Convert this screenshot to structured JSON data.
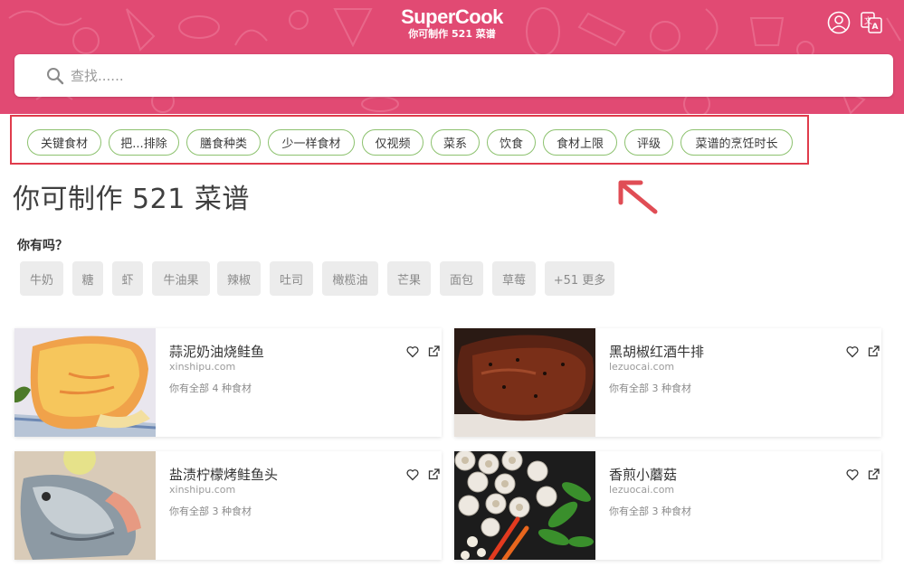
{
  "header": {
    "brand": "SuperCook",
    "subtitle": "你可制作 521 菜谱",
    "bg_color": "#e14a73",
    "icons": [
      "user-icon",
      "translate-icon"
    ]
  },
  "search": {
    "placeholder": "查找......"
  },
  "filters": [
    {
      "label": "关键食材"
    },
    {
      "label": "把...排除"
    },
    {
      "label": "膳食种类"
    },
    {
      "label": "少一样食材"
    },
    {
      "label": "仅视频"
    },
    {
      "label": "菜系"
    },
    {
      "label": "饮食"
    },
    {
      "label": "食材上限"
    },
    {
      "label": "评级"
    },
    {
      "label": "菜谱的烹饪时长"
    }
  ],
  "highlight_color": "#e03c4c",
  "main": {
    "title": "你可制作 521 菜谱",
    "have_label": "你有吗？",
    "suggestions": [
      "牛奶",
      "糖",
      "虾",
      "牛油果",
      "辣椒",
      "吐司",
      "橄榄油",
      "芒果",
      "面包",
      "草莓",
      "+51 更多"
    ]
  },
  "recipes": [
    {
      "title": "蒜泥奶油烧鲑鱼",
      "source": "xinshipu.com",
      "meta": "你有全部 4 种食材"
    },
    {
      "title": "黑胡椒红酒牛排",
      "source": "lezuocai.com",
      "meta": "你有全部 3 种食材"
    },
    {
      "title": "盐渍柠檬烤鲑鱼头",
      "source": "xinshipu.com",
      "meta": "你有全部 3 种食材"
    },
    {
      "title": "香煎小蘑菇",
      "source": "lezuocai.com",
      "meta": "你有全部 3 种食材"
    }
  ]
}
